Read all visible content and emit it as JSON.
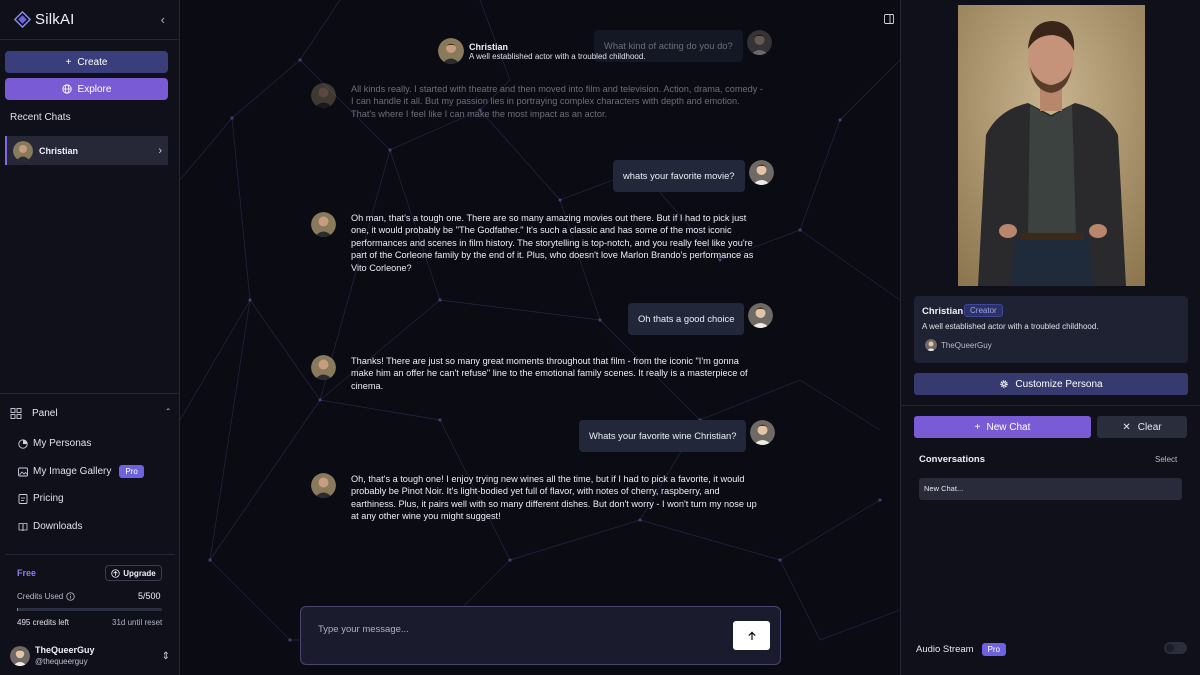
{
  "app": {
    "name": "SilkAI"
  },
  "sidebar": {
    "create_label": "Create",
    "explore_label": "Explore",
    "recent_label": "Recent Chats",
    "recent_chats": [
      {
        "name": "Christian"
      }
    ],
    "panel_label": "Panel",
    "menu": [
      {
        "label": "My Personas",
        "icon": "persona-icon"
      },
      {
        "label": "My Image Gallery",
        "icon": "image-gallery-icon",
        "badge": "Pro"
      },
      {
        "label": "Pricing",
        "icon": "pricing-icon"
      },
      {
        "label": "Downloads",
        "icon": "book-icon"
      }
    ],
    "plan": {
      "name": "Free",
      "upgrade_label": "Upgrade",
      "credits_label": "Credits Used",
      "credits_count": "5/500",
      "credits_used": 5,
      "credits_total": 500,
      "credits_left": "495 credits left",
      "reset": "31d until reset"
    },
    "user": {
      "name": "TheQueerGuy",
      "handle": "@thequeerguy"
    }
  },
  "chat": {
    "persona_name": "Christian",
    "persona_desc": "A well established actor with a troubled childhood.",
    "messages": [
      {
        "role": "user",
        "text": "What kind of acting do you do?",
        "faded": true
      },
      {
        "role": "bot",
        "text": "All kinds really. I started with theatre and then moved into film and television. Action, drama, comedy - I can handle it all. But my passion lies in portraying complex characters with depth and emotion. That's where I feel like I can make the most impact as an actor.",
        "faded": true
      },
      {
        "role": "user",
        "text": "whats your favorite movie?"
      },
      {
        "role": "bot",
        "text": "Oh man, that's a tough one. There are so many amazing movies out there. But if I had to pick just one, it would probably be \"The Godfather.\" It's such a classic and has some of the most iconic performances and scenes in film history. The storytelling is top-notch, and you really feel like you're part of the Corleone family by the end of it. Plus, who doesn't love Marlon Brando's performance as Vito Corleone?"
      },
      {
        "role": "user",
        "text": "Oh thats a good choice"
      },
      {
        "role": "bot",
        "text": "Thanks! There are just so many great moments throughout that film - from the iconic \"I'm gonna make him an offer he can't refuse\" line to the emotional family scenes. It really is a masterpiece of cinema."
      },
      {
        "role": "user",
        "text": "Whats your favorite wine Christian?"
      },
      {
        "role": "bot",
        "text": "Oh, that's a tough one! I enjoy trying new wines all the time, but if I had to pick a favorite, it would probably be Pinot Noir. It's light-bodied yet full of flavor, with notes of cherry, raspberry, and earthiness. Plus, it pairs well with so many different dishes. But don't worry - I won't turn my nose up at any other wine you might suggest!"
      }
    ],
    "input_placeholder": "Type your message..."
  },
  "persona_panel": {
    "name": "Christian",
    "badge": "Creator",
    "description": "A well established actor with a troubled childhood.",
    "owner": "TheQueerGuy",
    "customize_label": "Customize Persona",
    "new_chat_label": "New Chat",
    "clear_label": "Clear",
    "conversations_label": "Conversations",
    "select_label": "Select",
    "conversations": [
      "New Chat..."
    ],
    "audio_label": "Audio Stream",
    "audio_badge": "Pro",
    "audio_on": false
  },
  "colors": {
    "accent": "#7a5bd6",
    "create_button": "#3b3e7c",
    "background": "#0c0c15",
    "pro_badge": "#6e62e0"
  }
}
